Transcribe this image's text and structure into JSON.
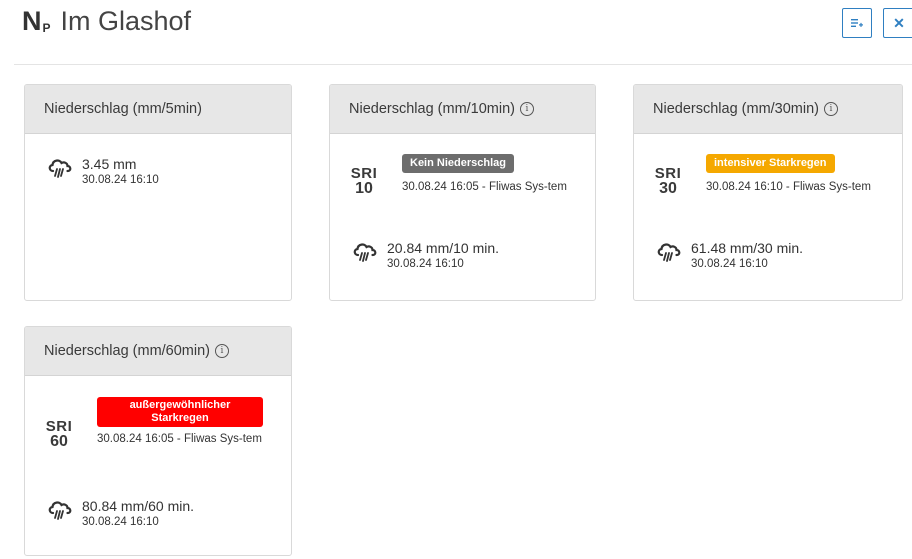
{
  "header": {
    "prefix": "N",
    "prefix_sub": "P",
    "station": "Im Glashof"
  },
  "icons": {
    "list": "list-add-icon",
    "close": "close-icon",
    "rain": "rain-cloud-icon",
    "info": "info-icon"
  },
  "colors": {
    "accent": "#2f7fc1",
    "badge_none": "#6d6d6d",
    "badge_intense": "#f5a800",
    "badge_extreme": "#ff0000"
  },
  "cards": [
    {
      "title": "Niederschlag (mm/5min)",
      "value": "3.45 mm",
      "timestamp": "30.08.24 16:10"
    },
    {
      "title": "Niederschlag (mm/10min)",
      "sri_label": "SRI",
      "sri_num": "10",
      "badge": "Kein Niederschlag",
      "sri_timestamp": "30.08.24 16:05 - Fliwas Sys-tem",
      "value": "20.84 mm/10 min.",
      "timestamp": "30.08.24 16:10"
    },
    {
      "title": "Niederschlag (mm/30min)",
      "sri_label": "SRI",
      "sri_num": "30",
      "badge": "intensiver Starkregen",
      "sri_timestamp": "30.08.24 16:10 - Fliwas Sys-tem",
      "value": "61.48 mm/30 min.",
      "timestamp": "30.08.24 16:10"
    },
    {
      "title": "Niederschlag (mm/60min)",
      "sri_label": "SRI",
      "sri_num": "60",
      "badge": "außergewöhnlicher Starkregen",
      "sri_timestamp": "30.08.24 16:05 - Fliwas Sys-tem",
      "value": "80.84 mm/60 min.",
      "timestamp": "30.08.24 16:10"
    }
  ]
}
